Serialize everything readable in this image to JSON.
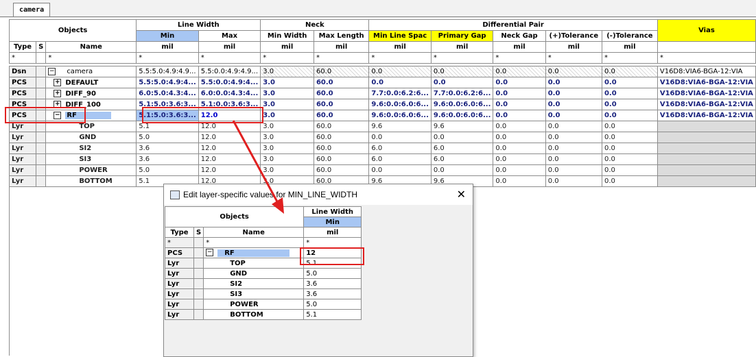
{
  "tab": {
    "label": "camera"
  },
  "headers": {
    "objects": "Objects",
    "line_width": "Line Width",
    "neck": "Neck",
    "diff_pair": "Differential Pair",
    "vias": "Vias",
    "type": "Type",
    "s": "S",
    "name": "Name",
    "min": "Min",
    "max": "Max",
    "min_width": "Min Width",
    "max_length": "Max Length",
    "min_line_spac": "Min Line Spac",
    "primary_gap": "Primary Gap",
    "neck_gap": "Neck Gap",
    "plus_tol": "(+)Tolerance",
    "minus_tol": "(-)Tolerance",
    "unit": "mil",
    "wildcard": "*"
  },
  "rows": [
    {
      "type": "Dsn",
      "expander": "−",
      "name": "camera",
      "min": "5.5:5.0:4.9:4.9...",
      "max": "5.5:0.0:4.9:4.9...",
      "min_width": "3.0",
      "max_length": "60.0",
      "min_line_spac": "0.0",
      "primary_gap": "0.0",
      "neck_gap": "0.0",
      "plus_tol": "0.0",
      "minus_tol": "0.0",
      "vias": "V16D8:VIA6-BGA-12:VIA"
    },
    {
      "type": "PCS",
      "expander": "+",
      "name": "DEFAULT",
      "min": "5.5:5.0:4.9:4...",
      "max": "5.5:0.0:4.9:4...",
      "min_width": "3.0",
      "max_length": "60.0",
      "min_line_spac": "0.0",
      "primary_gap": "0.0",
      "neck_gap": "0.0",
      "plus_tol": "0.0",
      "minus_tol": "0.0",
      "vias": "V16D8:VIA6-BGA-12:VIA"
    },
    {
      "type": "PCS",
      "expander": "+",
      "name": "DIFF_90",
      "min": "6.0:5.0:4.3:4...",
      "max": "6.0:0.0:4.3:4...",
      "min_width": "3.0",
      "max_length": "60.0",
      "min_line_spac": "7.7:0.0:6.2:6...",
      "primary_gap": "7.7:0.0:6.2:6...",
      "neck_gap": "0.0",
      "plus_tol": "0.0",
      "minus_tol": "0.0",
      "vias": "V16D8:VIA6-BGA-12:VIA"
    },
    {
      "type": "PCS",
      "expander": "+",
      "name": "DIFF_100",
      "min": "5.1:5.0:3.6:3...",
      "max": "5.1:0.0:3.6:3...",
      "min_width": "3.0",
      "max_length": "60.0",
      "min_line_spac": "9.6:0.0:6.0:6...",
      "primary_gap": "9.6:0.0:6.0:6...",
      "neck_gap": "0.0",
      "plus_tol": "0.0",
      "minus_tol": "0.0",
      "vias": "V16D8:VIA6-BGA-12:VIA"
    },
    {
      "type": "PCS",
      "expander": "−",
      "name": "RF",
      "min": "5.1:5.0:3.6:3...",
      "max": "12.0",
      "min_width": "3.0",
      "max_length": "60.0",
      "min_line_spac": "9.6:0.0:6.0:6...",
      "primary_gap": "9.6:0.0:6.0:6...",
      "neck_gap": "0.0",
      "plus_tol": "0.0",
      "minus_tol": "0.0",
      "vias": "V16D8:VIA6-BGA-12:VIA"
    }
  ],
  "layers": [
    {
      "type": "Lyr",
      "name": "TOP",
      "min": "5.1",
      "max": "12.0",
      "min_width": "3.0",
      "max_length": "60.0",
      "min_line_spac": "9.6",
      "primary_gap": "9.6",
      "neck_gap": "0.0",
      "plus_tol": "0.0",
      "minus_tol": "0.0"
    },
    {
      "type": "Lyr",
      "name": "GND",
      "min": "5.0",
      "max": "12.0",
      "min_width": "3.0",
      "max_length": "60.0",
      "min_line_spac": "0.0",
      "primary_gap": "0.0",
      "neck_gap": "0.0",
      "plus_tol": "0.0",
      "minus_tol": "0.0"
    },
    {
      "type": "Lyr",
      "name": "SI2",
      "min": "3.6",
      "max": "12.0",
      "min_width": "3.0",
      "max_length": "60.0",
      "min_line_spac": "6.0",
      "primary_gap": "6.0",
      "neck_gap": "0.0",
      "plus_tol": "0.0",
      "minus_tol": "0.0"
    },
    {
      "type": "Lyr",
      "name": "SI3",
      "min": "3.6",
      "max": "12.0",
      "min_width": "3.0",
      "max_length": "60.0",
      "min_line_spac": "6.0",
      "primary_gap": "6.0",
      "neck_gap": "0.0",
      "plus_tol": "0.0",
      "minus_tol": "0.0"
    },
    {
      "type": "Lyr",
      "name": "POWER",
      "min": "5.0",
      "max": "12.0",
      "min_width": "3.0",
      "max_length": "60.0",
      "min_line_spac": "0.0",
      "primary_gap": "0.0",
      "neck_gap": "0.0",
      "plus_tol": "0.0",
      "minus_tol": "0.0"
    },
    {
      "type": "Lyr",
      "name": "BOTTOM",
      "min": "5.1",
      "max": "12.0",
      "min_width": "3.0",
      "max_length": "60.0",
      "min_line_spac": "9.6",
      "primary_gap": "9.6",
      "neck_gap": "0.0",
      "plus_tol": "0.0",
      "minus_tol": "0.0"
    }
  ],
  "dialog": {
    "title": "Edit layer-specific values for MIN_LINE_WIDTH",
    "close": "✕",
    "objects": "Objects",
    "line_width": "Line Width",
    "min": "Min",
    "type": "Type",
    "s": "S",
    "name": "Name",
    "unit": "mil",
    "wildcard": "*",
    "pcs_row": {
      "type": "PCS",
      "expander": "−",
      "name": "RF",
      "value": "12"
    },
    "layers": [
      {
        "type": "Lyr",
        "name": "TOP",
        "value": "5.1"
      },
      {
        "type": "Lyr",
        "name": "GND",
        "value": "5.0"
      },
      {
        "type": "Lyr",
        "name": "SI2",
        "value": "3.6"
      },
      {
        "type": "Lyr",
        "name": "SI3",
        "value": "3.6"
      },
      {
        "type": "Lyr",
        "name": "POWER",
        "value": "5.0"
      },
      {
        "type": "Lyr",
        "name": "BOTTOM",
        "value": "5.1"
      }
    ]
  },
  "colors": {
    "highlight_yellow": "#ffff00",
    "select_blue": "#a7c6f3",
    "annotation_red": "#e02020"
  }
}
